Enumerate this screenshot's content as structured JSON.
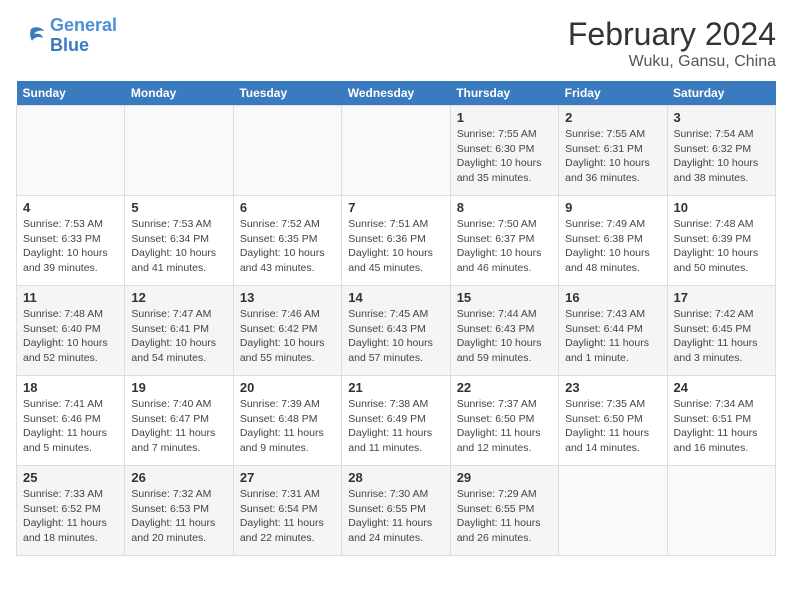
{
  "logo": {
    "line1": "General",
    "line2": "Blue"
  },
  "title": "February 2024",
  "subtitle": "Wuku, Gansu, China",
  "days_of_week": [
    "Sunday",
    "Monday",
    "Tuesday",
    "Wednesday",
    "Thursday",
    "Friday",
    "Saturday"
  ],
  "weeks": [
    [
      {
        "day": "",
        "info": ""
      },
      {
        "day": "",
        "info": ""
      },
      {
        "day": "",
        "info": ""
      },
      {
        "day": "",
        "info": ""
      },
      {
        "day": "1",
        "info": "Sunrise: 7:55 AM\nSunset: 6:30 PM\nDaylight: 10 hours\nand 35 minutes."
      },
      {
        "day": "2",
        "info": "Sunrise: 7:55 AM\nSunset: 6:31 PM\nDaylight: 10 hours\nand 36 minutes."
      },
      {
        "day": "3",
        "info": "Sunrise: 7:54 AM\nSunset: 6:32 PM\nDaylight: 10 hours\nand 38 minutes."
      }
    ],
    [
      {
        "day": "4",
        "info": "Sunrise: 7:53 AM\nSunset: 6:33 PM\nDaylight: 10 hours\nand 39 minutes."
      },
      {
        "day": "5",
        "info": "Sunrise: 7:53 AM\nSunset: 6:34 PM\nDaylight: 10 hours\nand 41 minutes."
      },
      {
        "day": "6",
        "info": "Sunrise: 7:52 AM\nSunset: 6:35 PM\nDaylight: 10 hours\nand 43 minutes."
      },
      {
        "day": "7",
        "info": "Sunrise: 7:51 AM\nSunset: 6:36 PM\nDaylight: 10 hours\nand 45 minutes."
      },
      {
        "day": "8",
        "info": "Sunrise: 7:50 AM\nSunset: 6:37 PM\nDaylight: 10 hours\nand 46 minutes."
      },
      {
        "day": "9",
        "info": "Sunrise: 7:49 AM\nSunset: 6:38 PM\nDaylight: 10 hours\nand 48 minutes."
      },
      {
        "day": "10",
        "info": "Sunrise: 7:48 AM\nSunset: 6:39 PM\nDaylight: 10 hours\nand 50 minutes."
      }
    ],
    [
      {
        "day": "11",
        "info": "Sunrise: 7:48 AM\nSunset: 6:40 PM\nDaylight: 10 hours\nand 52 minutes."
      },
      {
        "day": "12",
        "info": "Sunrise: 7:47 AM\nSunset: 6:41 PM\nDaylight: 10 hours\nand 54 minutes."
      },
      {
        "day": "13",
        "info": "Sunrise: 7:46 AM\nSunset: 6:42 PM\nDaylight: 10 hours\nand 55 minutes."
      },
      {
        "day": "14",
        "info": "Sunrise: 7:45 AM\nSunset: 6:43 PM\nDaylight: 10 hours\nand 57 minutes."
      },
      {
        "day": "15",
        "info": "Sunrise: 7:44 AM\nSunset: 6:43 PM\nDaylight: 10 hours\nand 59 minutes."
      },
      {
        "day": "16",
        "info": "Sunrise: 7:43 AM\nSunset: 6:44 PM\nDaylight: 11 hours\nand 1 minute."
      },
      {
        "day": "17",
        "info": "Sunrise: 7:42 AM\nSunset: 6:45 PM\nDaylight: 11 hours\nand 3 minutes."
      }
    ],
    [
      {
        "day": "18",
        "info": "Sunrise: 7:41 AM\nSunset: 6:46 PM\nDaylight: 11 hours\nand 5 minutes."
      },
      {
        "day": "19",
        "info": "Sunrise: 7:40 AM\nSunset: 6:47 PM\nDaylight: 11 hours\nand 7 minutes."
      },
      {
        "day": "20",
        "info": "Sunrise: 7:39 AM\nSunset: 6:48 PM\nDaylight: 11 hours\nand 9 minutes."
      },
      {
        "day": "21",
        "info": "Sunrise: 7:38 AM\nSunset: 6:49 PM\nDaylight: 11 hours\nand 11 minutes."
      },
      {
        "day": "22",
        "info": "Sunrise: 7:37 AM\nSunset: 6:50 PM\nDaylight: 11 hours\nand 12 minutes."
      },
      {
        "day": "23",
        "info": "Sunrise: 7:35 AM\nSunset: 6:50 PM\nDaylight: 11 hours\nand 14 minutes."
      },
      {
        "day": "24",
        "info": "Sunrise: 7:34 AM\nSunset: 6:51 PM\nDaylight: 11 hours\nand 16 minutes."
      }
    ],
    [
      {
        "day": "25",
        "info": "Sunrise: 7:33 AM\nSunset: 6:52 PM\nDaylight: 11 hours\nand 18 minutes."
      },
      {
        "day": "26",
        "info": "Sunrise: 7:32 AM\nSunset: 6:53 PM\nDaylight: 11 hours\nand 20 minutes."
      },
      {
        "day": "27",
        "info": "Sunrise: 7:31 AM\nSunset: 6:54 PM\nDaylight: 11 hours\nand 22 minutes."
      },
      {
        "day": "28",
        "info": "Sunrise: 7:30 AM\nSunset: 6:55 PM\nDaylight: 11 hours\nand 24 minutes."
      },
      {
        "day": "29",
        "info": "Sunrise: 7:29 AM\nSunset: 6:55 PM\nDaylight: 11 hours\nand 26 minutes."
      },
      {
        "day": "",
        "info": ""
      },
      {
        "day": "",
        "info": ""
      }
    ]
  ]
}
